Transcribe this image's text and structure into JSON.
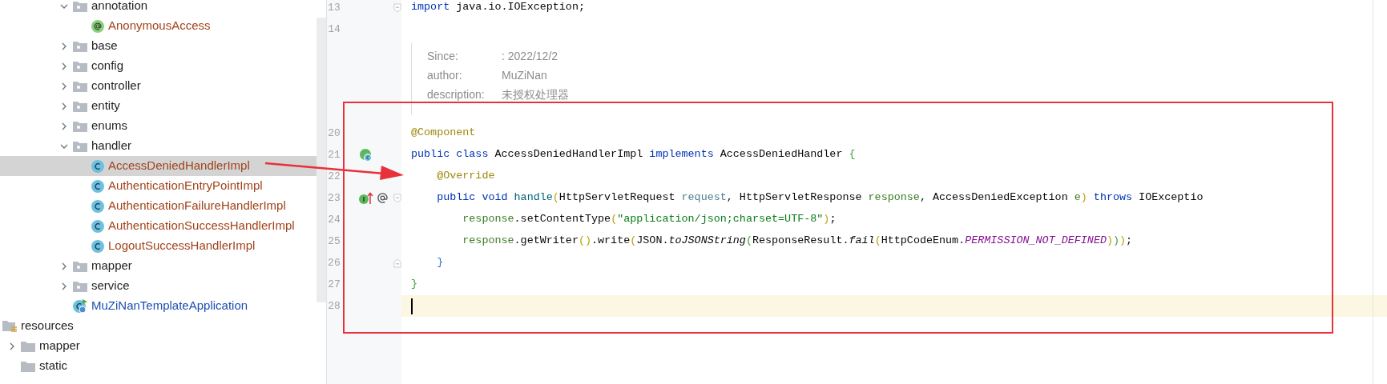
{
  "project_tree": {
    "package_contents": [
      {
        "label": "annotation",
        "kind": "folder",
        "expanded": true,
        "selected": false,
        "children": [
          {
            "label": "AnonymousAccess",
            "kind": "annotation",
            "selected": false
          }
        ]
      },
      {
        "label": "base",
        "kind": "folder",
        "expanded": false,
        "selected": false
      },
      {
        "label": "config",
        "kind": "folder",
        "expanded": false,
        "selected": false
      },
      {
        "label": "controller",
        "kind": "folder",
        "expanded": false,
        "selected": false
      },
      {
        "label": "entity",
        "kind": "folder",
        "expanded": false,
        "selected": false
      },
      {
        "label": "enums",
        "kind": "folder",
        "expanded": false,
        "selected": false
      },
      {
        "label": "handler",
        "kind": "folder",
        "expanded": true,
        "selected": false,
        "children": [
          {
            "label": "AccessDeniedHandlerImpl",
            "kind": "class",
            "selected": true
          },
          {
            "label": "AuthenticationEntryPointImpl",
            "kind": "class",
            "selected": false
          },
          {
            "label": "AuthenticationFailureHandlerImpl",
            "kind": "class",
            "selected": false
          },
          {
            "label": "AuthenticationSuccessHandlerImpl",
            "kind": "class",
            "selected": false
          },
          {
            "label": "LogoutSuccessHandlerImpl",
            "kind": "class",
            "selected": false
          }
        ]
      },
      {
        "label": "mapper",
        "kind": "folder",
        "expanded": false,
        "selected": false
      },
      {
        "label": "service",
        "kind": "folder",
        "expanded": false,
        "selected": false
      },
      {
        "label": "MuZiNanTemplateApplication",
        "kind": "app",
        "selected": false
      }
    ],
    "resources": [
      {
        "label": "resources",
        "kind": "resource_root",
        "selected": false,
        "children": [
          {
            "label": "mapper",
            "kind": "plain_folder",
            "expanded": false,
            "selected": false
          },
          {
            "label": "static",
            "kind": "plain_folder",
            "selected": false
          }
        ]
      }
    ]
  },
  "editor": {
    "lines": [
      {
        "kind": "code",
        "number": "13",
        "current": false,
        "fold_mark": {
          "kind": "start"
        },
        "tokens": [
          {
            "text": "import",
            "kind": "keyword"
          },
          {
            "text": " java.io.IOException;",
            "kind": "plain"
          }
        ]
      },
      {
        "kind": "code",
        "number": "14",
        "current": false
      },
      {
        "kind": "doc",
        "rows": [
          {
            "label": "Since:",
            "value": ": 2022/12/2"
          },
          {
            "label": "author:",
            "value": "MuZiNan"
          },
          {
            "label": "description:",
            "value": "未授权处理器"
          }
        ]
      },
      {
        "kind": "code",
        "number": "20",
        "current": false,
        "tokens": [
          {
            "text": "@Component",
            "kind": "annotation"
          }
        ]
      },
      {
        "kind": "code",
        "number": "21",
        "current": false,
        "gutter_icons": [
          {
            "kind": "implemented_class"
          }
        ],
        "tokens": [
          {
            "text": "public class",
            "kind": "keyword"
          },
          {
            "text": " AccessDeniedHandlerImpl ",
            "kind": "plain"
          },
          {
            "text": "implements",
            "kind": "keyword"
          },
          {
            "text": " AccessDeniedHandler ",
            "kind": "plain"
          },
          {
            "text": "{",
            "kind": "bracket_green"
          }
        ]
      },
      {
        "kind": "code",
        "number": "22",
        "current": false,
        "tokens": [
          {
            "text": "    @Override",
            "kind": "annotation"
          }
        ]
      },
      {
        "kind": "code",
        "number": "23",
        "current": false,
        "gutter_icons": [
          {
            "kind": "implements_method"
          },
          {
            "kind": "annotated"
          }
        ],
        "fold_mark": {
          "kind": "start"
        },
        "tokens": [
          {
            "text": "    public void ",
            "kind": "keyword"
          },
          {
            "text": "handle",
            "kind": "method_decl"
          },
          {
            "text": "(",
            "kind": "bracket_yellow"
          },
          {
            "text": "HttpServletRequest ",
            "kind": "plain"
          },
          {
            "text": "request",
            "kind": "param_unused"
          },
          {
            "text": ", HttpServletResponse ",
            "kind": "plain"
          },
          {
            "text": "response",
            "kind": "param"
          },
          {
            "text": ", AccessDeniedException ",
            "kind": "plain"
          },
          {
            "text": "e",
            "kind": "param"
          },
          {
            "text": ")",
            "kind": "bracket_yellow"
          },
          {
            "text": " throws",
            "kind": "keyword"
          },
          {
            "text": " IOExceptio",
            "kind": "plain"
          }
        ]
      },
      {
        "kind": "code",
        "number": "24",
        "current": false,
        "tokens": [
          {
            "text": "        response",
            "kind": "param"
          },
          {
            "text": ".setContentType",
            "kind": "plain"
          },
          {
            "text": "(",
            "kind": "bracket_yellow"
          },
          {
            "text": "\"application/json;charset=UTF-8\"",
            "kind": "string"
          },
          {
            "text": ")",
            "kind": "bracket_yellow"
          },
          {
            "text": ";",
            "kind": "plain"
          }
        ]
      },
      {
        "kind": "code",
        "number": "25",
        "current": false,
        "tokens": [
          {
            "text": "        response",
            "kind": "param"
          },
          {
            "text": ".getWriter",
            "kind": "plain"
          },
          {
            "text": "()",
            "kind": "bracket_yellow"
          },
          {
            "text": ".write",
            "kind": "plain"
          },
          {
            "text": "(",
            "kind": "bracket_yellow"
          },
          {
            "text": "JSON.",
            "kind": "plain"
          },
          {
            "text": "toJSONString",
            "kind": "static_method"
          },
          {
            "text": "(",
            "kind": "bracket_green"
          },
          {
            "text": "ResponseResult.",
            "kind": "plain"
          },
          {
            "text": "fail",
            "kind": "static_method"
          },
          {
            "text": "(",
            "kind": "bracket_yellow"
          },
          {
            "text": "HttpCodeEnum.",
            "kind": "plain"
          },
          {
            "text": "PERMISSION_NOT_DEFINED",
            "kind": "constant"
          },
          {
            "text": ")",
            "kind": "bracket_yellow"
          },
          {
            "text": ")",
            "kind": "bracket_green"
          },
          {
            "text": ")",
            "kind": "bracket_yellow"
          },
          {
            "text": ";",
            "kind": "plain"
          }
        ]
      },
      {
        "kind": "code",
        "number": "26",
        "current": false,
        "fold_mark": {
          "kind": "end"
        },
        "tokens": [
          {
            "text": "    }",
            "kind": "bracket_blue"
          }
        ]
      },
      {
        "kind": "code",
        "number": "27",
        "current": false,
        "tokens": [
          {
            "text": "}",
            "kind": "bracket_green"
          }
        ]
      },
      {
        "kind": "code",
        "number": "28",
        "current": true
      }
    ]
  }
}
